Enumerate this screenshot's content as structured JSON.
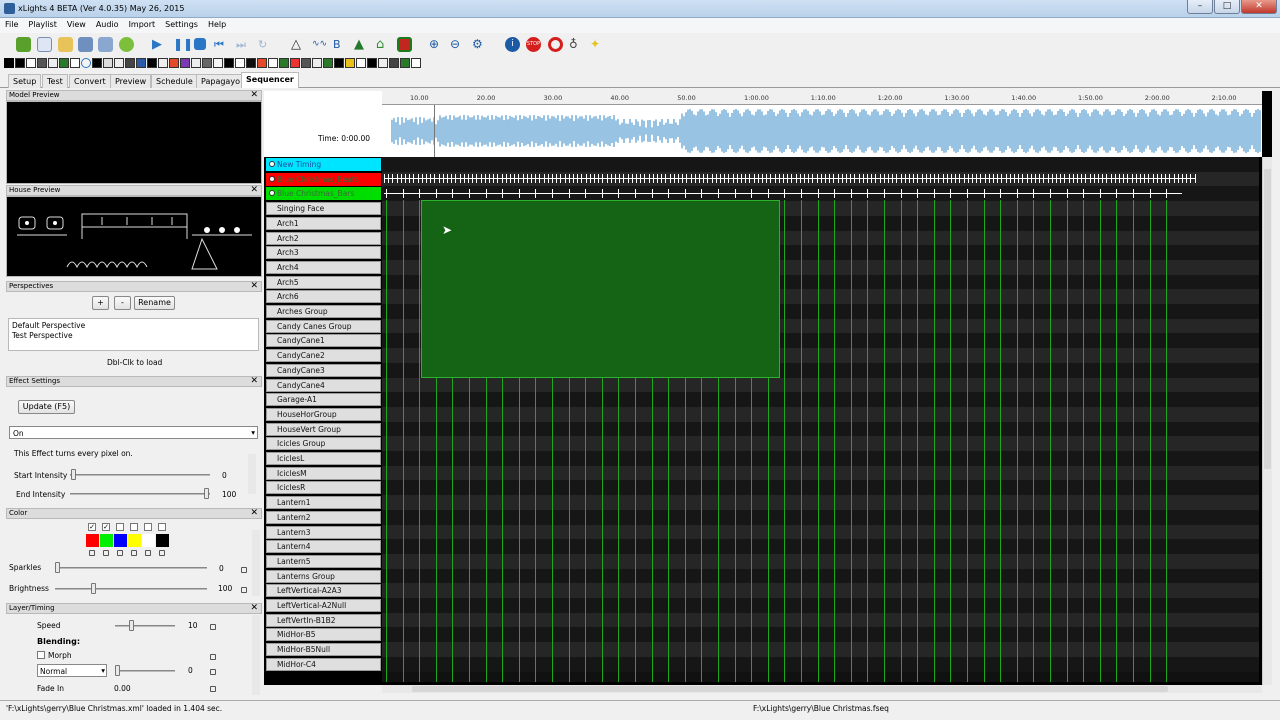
{
  "window": {
    "title": "xLights 4 BETA (Ver 4.0.35) May 26, 2015"
  },
  "menu": [
    "File",
    "Playlist",
    "View",
    "Audio",
    "Import",
    "Settings",
    "Help"
  ],
  "tabs": [
    "Setup",
    "Test",
    "Convert",
    "Preview",
    "Schedule",
    "Papagayo",
    "Sequencer"
  ],
  "active_tab": "Sequencer",
  "panels": {
    "model_preview": "Model Preview",
    "house_preview": "House Preview",
    "perspectives": {
      "title": "Perspectives",
      "add": "+",
      "remove": "-",
      "rename": "Rename",
      "items": [
        "Default Perspective",
        "Test Perspective"
      ],
      "hint": "Dbl-Clk to load"
    },
    "effect_settings": {
      "title": "Effect Settings",
      "update": "Update (F5)",
      "effect": "On",
      "description": "This Effect turns every pixel on.",
      "start_label": "Start Intensity",
      "start_value": "0",
      "end_label": "End Intensity",
      "end_value": "100"
    },
    "color": {
      "title": "Color",
      "swatches": [
        "#ff0000",
        "#00ee00",
        "#0000ff",
        "#ffff00",
        "#ffffff",
        "#000000"
      ],
      "sparkles_label": "Sparkles",
      "sparkles_value": "0",
      "brightness_label": "Brightness",
      "brightness_value": "100"
    },
    "layer_timing": {
      "title": "Layer/Timing",
      "speed_label": "Speed",
      "speed_value": "10",
      "blending_label": "Blending:",
      "morph_label": "Morph",
      "mode": "Normal",
      "mode_value": "0",
      "fade_in_label": "Fade In",
      "fade_in_value": "0.00"
    }
  },
  "sequencer": {
    "time_label": "Time: 0:00.00",
    "ruler": [
      "10.00",
      "20.00",
      "30.00",
      "40.00",
      "50.00",
      "1:00.00",
      "1:10.00",
      "1:20.00",
      "1:30.00",
      "1:40.00",
      "1:50.00",
      "2:00.00",
      "2:10.00"
    ],
    "timing_tracks": [
      {
        "label": "New Timing",
        "color": "#00e5ff"
      },
      {
        "label": "Blue Christmas_Beats",
        "color": "#ff0000"
      },
      {
        "label": "Blue Christmas_Bars",
        "color": "#00dd00"
      }
    ],
    "models": [
      "Singing Face",
      "Arch1",
      "Arch2",
      "Arch3",
      "Arch4",
      "Arch5",
      "Arch6",
      "Arches Group",
      "Candy Canes Group",
      "CandyCane1",
      "CandyCane2",
      "CandyCane3",
      "CandyCane4",
      "Garage-A1",
      "HouseHorGroup",
      "HouseVert Group",
      "Icicles Group",
      "IciclesL",
      "IciclesM",
      "IciclesR",
      "Lantern1",
      "Lantern2",
      "Lantern3",
      "Lantern4",
      "Lantern5",
      "Lanterns Group",
      "LeftVertical-A2A3",
      "LeftVertical-A2Null",
      "LeftVertIn-B1B2",
      "MidHor-B5",
      "MidHor-B5Null",
      "MidHor-C4"
    ]
  },
  "status": {
    "left": "'F:\\xLights\\gerry\\Blue Christmas.xml' loaded in 1.404 sec.",
    "right": "F:\\xLights\\gerry\\Blue Christmas.fseq"
  }
}
